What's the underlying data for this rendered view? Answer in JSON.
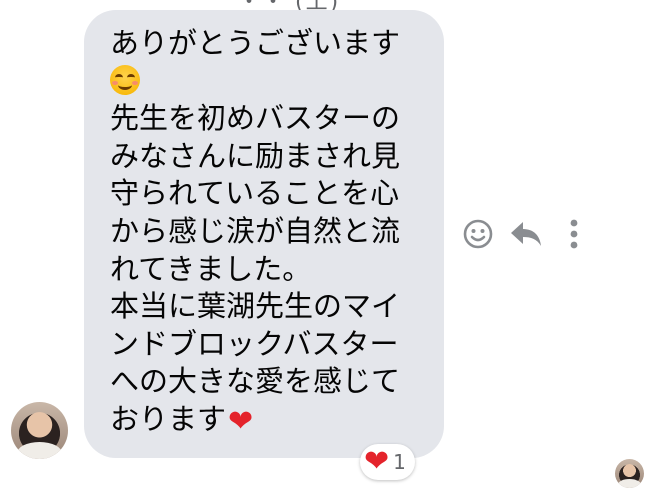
{
  "top_fragment": "・・ (工)",
  "message": {
    "lines": [
      "ありがとうございます",
      "",
      "先生を初めバスターの",
      "みなさんに励まされ見",
      "守られていることを心",
      "から感じ涙が自然と流",
      "れてきました。",
      "本当に葉湖先生のマイ",
      "ンドブロックバスター",
      "への大きな愛を感じて",
      "おります"
    ],
    "emoji_smile": "smiling-face-with-blush-icon",
    "emoji_heart": "❤"
  },
  "reaction": {
    "icon": "❤",
    "count": "1"
  },
  "actions": {
    "react_icon": "smiley-icon",
    "reply_icon": "reply-icon",
    "more_icon": "more-vertical-icon"
  },
  "colors": {
    "bubble": "#e4e6eb",
    "text": "#050505",
    "icon": "#8a8d91",
    "heart": "#e4232b"
  }
}
